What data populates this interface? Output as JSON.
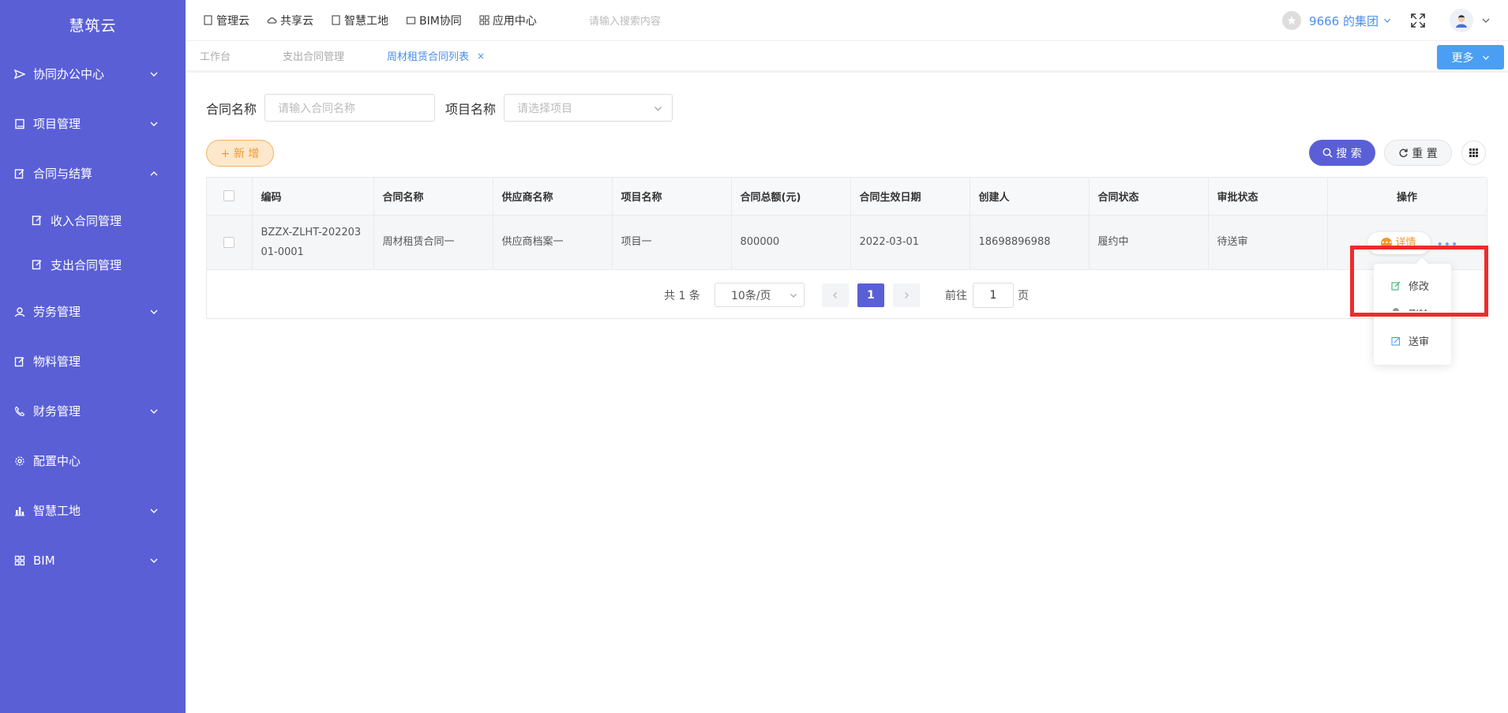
{
  "sidebar": {
    "logo": "慧筑云",
    "items": [
      {
        "label": "协同办公中心"
      },
      {
        "label": "项目管理"
      },
      {
        "label": "合同与结算"
      },
      {
        "label": "收入合同管理"
      },
      {
        "label": "支出合同管理"
      },
      {
        "label": "劳务管理"
      },
      {
        "label": "物料管理"
      },
      {
        "label": "财务管理"
      },
      {
        "label": "配置中心"
      },
      {
        "label": "智慧工地"
      },
      {
        "label": "BIM"
      }
    ]
  },
  "topbar": {
    "links": [
      "管理云",
      "共享云",
      "智慧工地",
      "BIM协同",
      "应用中心"
    ],
    "search_placeholder": "请输入搜索内容",
    "org_name": "9666 的集团"
  },
  "tabs": {
    "items": [
      {
        "label": "工作台"
      },
      {
        "label": "支出合同管理"
      },
      {
        "label": "周材租赁合同列表",
        "close": "×"
      }
    ],
    "more_label": "更多"
  },
  "filters": {
    "contract_name_label": "合同名称",
    "contract_name_placeholder": "请输入合同名称",
    "project_name_label": "项目名称",
    "project_name_placeholder": "请选择项目"
  },
  "actions": {
    "add_label": "+ 新 增",
    "search_label": "搜 索",
    "reset_label": "重 置"
  },
  "table": {
    "headers": [
      "编码",
      "合同名称",
      "供应商名称",
      "项目名称",
      "合同总额(元)",
      "合同生效日期",
      "创建人",
      "合同状态",
      "审批状态",
      "操作"
    ],
    "rows": [
      {
        "code_line1": "BZZX-ZLHT-202203",
        "code_line2": "01-0001",
        "contract_name": "周材租赁合同一",
        "supplier": "供应商档案一",
        "project": "项目一",
        "amount": "800000",
        "effective_date": "2022-03-01",
        "creator": "18698896988",
        "contract_status": "履约中",
        "approval_status": "待送审",
        "detail_label": "详情",
        "more_label": "•••"
      }
    ]
  },
  "pagination": {
    "total_text": "共 1 条",
    "page_size": "10条/页",
    "current_page": "1",
    "goto_label": "前往",
    "goto_value": "1",
    "goto_unit": "页"
  },
  "dropdown": {
    "items": [
      "修改",
      "删除",
      "送审"
    ]
  },
  "colors": {
    "sidebar": "#5a5fd6",
    "accent": "#4a8ef0",
    "add_button": "#f2992e",
    "highlight": "#ef2b2b"
  }
}
